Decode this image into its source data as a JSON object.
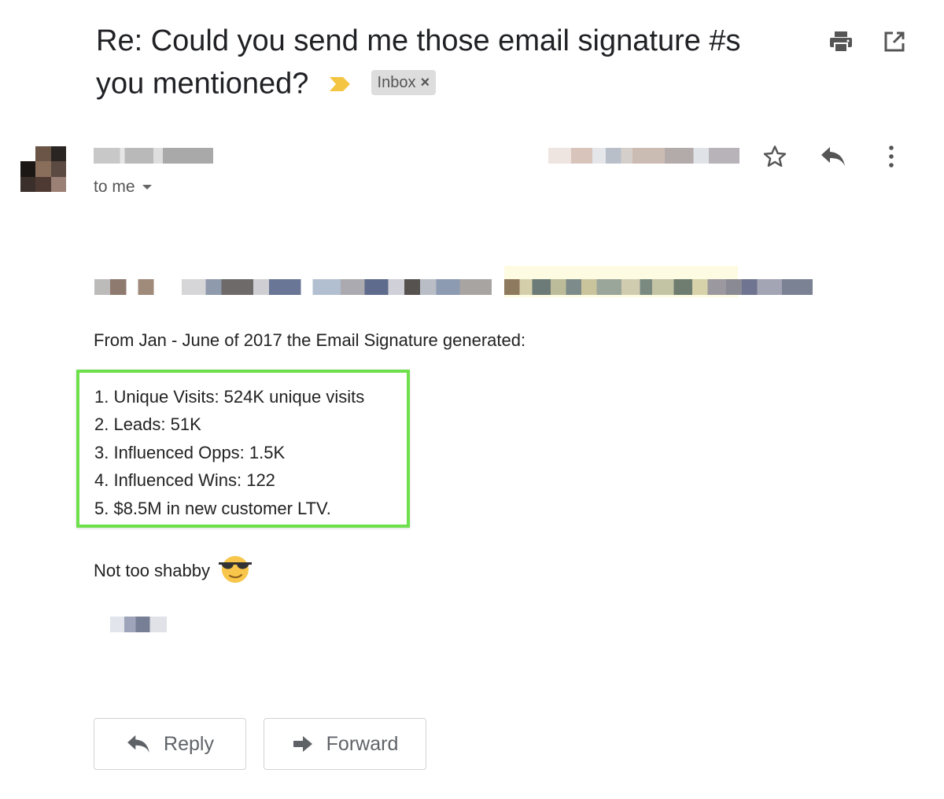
{
  "email": {
    "subject": "Re: Could you send me those email signature #s you mentioned?",
    "label_chip": "Inbox",
    "label_chip_close": "×",
    "recipient": "to me",
    "intro": "From Jan - June of 2017 the Email Signature generated:",
    "stats": [
      "1. Unique Visits: 524K unique visits",
      "2. Leads: 51K",
      "3. Influenced Opps: 1.5K",
      "4. Influenced Wins: 122",
      "5. $8.5M in new customer LTV."
    ],
    "closing": "Not too shabby",
    "closing_emoji": "smiling-face-with-sunglasses-icon"
  },
  "toolbar_icons": [
    "print-icon",
    "open-in-new-window-icon"
  ],
  "message_actions": [
    "star-icon",
    "reply-icon",
    "more-options-icon"
  ],
  "buttons": {
    "reply_label": "Reply",
    "forward_label": "Forward"
  },
  "colors": {
    "highlight_border": "#6de04c",
    "importance_marker": "#f4c542",
    "chip_background": "#dddddd"
  }
}
